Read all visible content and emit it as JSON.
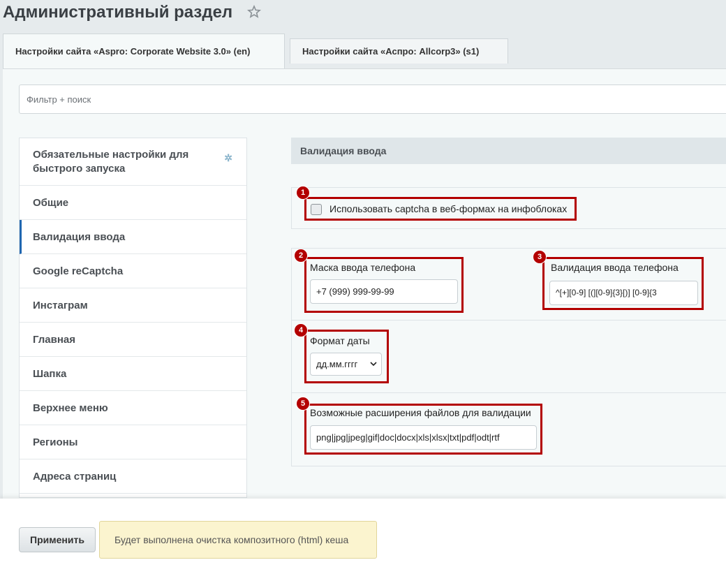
{
  "header": {
    "title": "Административный раздел"
  },
  "tabs": [
    {
      "label": "Настройки сайта «Aspro: Corporate Website 3.0» (en)",
      "active": true
    },
    {
      "label": "Настройки сайта «Аспро: Allcorp3» (s1)",
      "active": false
    }
  ],
  "filter": {
    "placeholder": "Фильтр + поиск"
  },
  "sidebar": {
    "items": [
      {
        "label": "Обязательные настройки для быстрого запуска",
        "pin_icon": "pin-icon"
      },
      {
        "label": "Общие"
      },
      {
        "label": "Валидация ввода",
        "active": true
      },
      {
        "label": "Google reCaptcha"
      },
      {
        "label": "Инстаграм"
      },
      {
        "label": "Главная"
      },
      {
        "label": "Шапка"
      },
      {
        "label": "Верхнее меню"
      },
      {
        "label": "Регионы"
      },
      {
        "label": "Адреса страниц"
      }
    ]
  },
  "section": {
    "title": "Валидация ввода"
  },
  "fields": {
    "captcha": {
      "badge": "1",
      "label": "Использовать captcha в веб-формах на инфоблоках",
      "checked": false
    },
    "phone_mask": {
      "badge": "2",
      "label": "Маска ввода телефона",
      "value": "+7 (999) 999-99-99"
    },
    "phone_validation": {
      "badge": "3",
      "label": "Валидация ввода телефона",
      "value": "^[+][0-9] [(][0-9]{3}[)] [0-9]{3"
    },
    "date_format": {
      "badge": "4",
      "label": "Формат даты",
      "value": "дд.мм.гггг"
    },
    "file_ext": {
      "badge": "5",
      "label": "Возможные расширения файлов для валидации",
      "value": "png|jpg|jpeg|gif|doc|docx|xls|xlsx|txt|pdf|odt|rtf"
    }
  },
  "footer": {
    "apply_label": "Применить",
    "notice": "Будет выполнена очистка композитного (html) кеша"
  },
  "colors": {
    "highlight": "#b30000",
    "active_accent": "#2066b0",
    "notice_bg": "#fbf4cf"
  }
}
